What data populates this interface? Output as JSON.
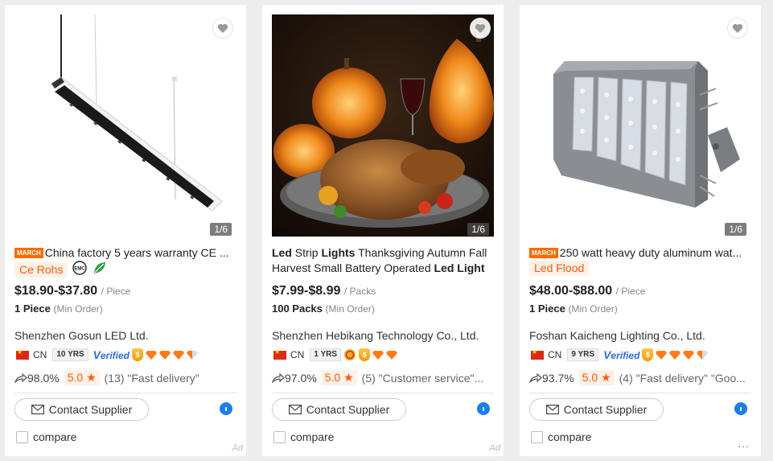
{
  "ui": {
    "image_counter": "1/6",
    "contact_label": "Contact Supplier",
    "compare_label": "compare",
    "ad_label": "Ad",
    "more_label": "...",
    "march_label": "MARCH",
    "verified_label": "erified",
    "verified_v": "V",
    "star_glyph": "★"
  },
  "products": [
    {
      "title": "China factory 5 years warranty CE ...",
      "tags": [
        "Ce Rohs"
      ],
      "cert_icons": [
        "emc-icon",
        "rohs-icon"
      ],
      "price": "$18.90-$37.80",
      "unit": "/ Piece",
      "moq": "1 Piece",
      "moq_note": "(Min Order)",
      "supplier": "Shenzhen Gosun LED Ltd.",
      "country": "CN",
      "years": "10 YRS",
      "response_rate": "98.0%",
      "score": "5.0",
      "review": "(13) \"Fast delivery\""
    },
    {
      "title_parts": [
        "Led",
        " Strip ",
        "Lights",
        " Thanksgiving Autumn Fall Harvest Small Battery Operated ",
        "Led Light"
      ],
      "price": "$7.99-$8.99",
      "unit": "/ Packs",
      "moq": "100 Packs",
      "moq_note": "(Min Order)",
      "supplier": "Shenzhen Hebikang Technology Co., Ltd.",
      "country": "CN",
      "years": "1 YRS",
      "response_rate": "97.0%",
      "score": "5.0",
      "review": "(5) \"Customer service\"..."
    },
    {
      "title": "250 watt heavy duty aluminum wat...",
      "tags": [
        "Led Flood"
      ],
      "price": "$48.00-$88.00",
      "unit": "/ Piece",
      "moq": "1 Piece",
      "moq_note": "(Min Order)",
      "supplier": "Foshan Kaicheng Lighting Co., Ltd.",
      "country": "CN",
      "years": "9 YRS",
      "response_rate": "93.7%",
      "score": "5.0",
      "review": "(4) \"Fast delivery\"  \"Goo..."
    }
  ],
  "colors": {
    "accent": "#ff6a00",
    "tag_bg": "#fff1e8",
    "verified": "#2c6ce0",
    "chat": "#1a7fe8"
  }
}
